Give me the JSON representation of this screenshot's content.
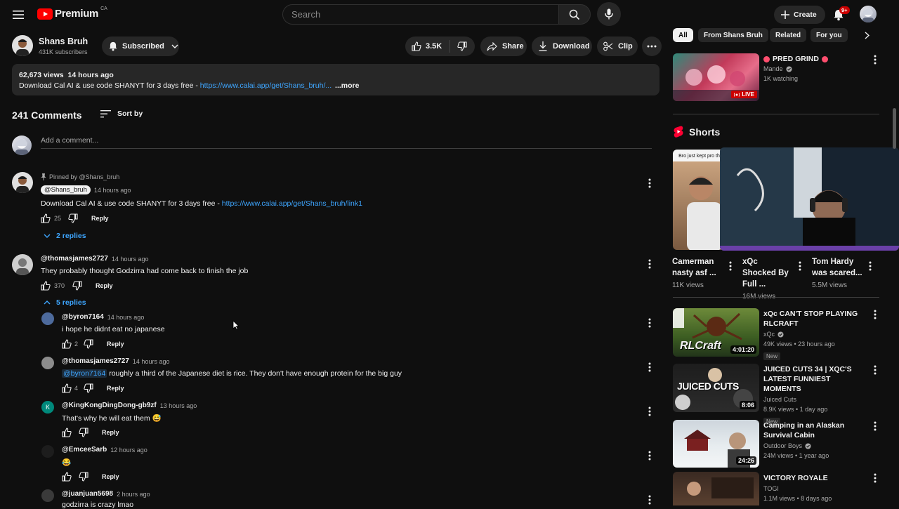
{
  "header": {
    "logo_text": "Premium",
    "region": "CA",
    "search_placeholder": "Search",
    "create_label": "Create",
    "notification_count": "9+"
  },
  "channel": {
    "name": "Shans Bruh",
    "subscribers": "431K subscribers",
    "subscribed_label": "Subscribed",
    "likes": "3.5K",
    "share_label": "Share",
    "download_label": "Download",
    "clip_label": "Clip"
  },
  "description": {
    "views": "62,673 views",
    "age": "14 hours ago",
    "text": "Download Cal AI & use code SHANYT for 3 days free - ",
    "link": "https://www.calai.app/get/Shans_bruh/...",
    "more": "...more"
  },
  "comments_header": {
    "count_label": "241 Comments",
    "sort_label": "Sort by",
    "add_placeholder": "Add a comment..."
  },
  "comments": [
    {
      "pinned": "Pinned by @Shans_bruh",
      "handle": "@Shans_bruh",
      "time": "14 hours ago",
      "text": "Download Cal AI & use code SHANYT for 3 days free - ",
      "link": "https://www.calai.app/get/Shans_bruh/link1",
      "likes": "25",
      "reply": "Reply",
      "replies_toggle": "2 replies"
    },
    {
      "handle": "@thomasjames2727",
      "time": "14 hours ago",
      "text": "They probably thought Godzirra had come back to finish the job",
      "likes": "370",
      "reply": "Reply",
      "replies_toggle": "5 replies"
    }
  ],
  "replies": [
    {
      "handle": "@byron7164",
      "time": "14 hours ago",
      "text": "i hope he didnt eat no japanese",
      "likes": "2",
      "reply": "Reply"
    },
    {
      "handle": "@thomasjames2727",
      "time": "14 hours ago",
      "mention": "@byron7164",
      "text": " roughly a third of the Japanese diet is rice. They don't have enough protein for the big guy",
      "likes": "4",
      "reply": "Reply"
    },
    {
      "handle": "@KingKongDingDong-gb9zf",
      "time": "13 hours ago",
      "text": "That's why he will eat them 😅",
      "likes": "",
      "reply": "Reply",
      "avatar_letter": "K"
    },
    {
      "handle": "@EmceeSarb",
      "time": "12 hours ago",
      "text": "😂",
      "likes": "",
      "reply": "Reply"
    },
    {
      "handle": "@juanjuan5698",
      "time": "2 hours ago",
      "text": "godzirra is crazy lmao",
      "likes": "",
      "reply": "Reply"
    }
  ],
  "sidebar": {
    "chips": [
      "All",
      "From Shans Bruh",
      "Related",
      "For you"
    ],
    "live": {
      "title": "PRED GRIND",
      "channel": "Mande",
      "meta": "1K watching",
      "badge": "LIVE"
    },
    "shorts_title": "Shorts",
    "shorts": [
      {
        "title": "Camerman nasty asf ...",
        "views": "11K views",
        "overlay": "Bro just kept pro the point"
      },
      {
        "title": "xQc Shocked By Full ...",
        "views": "16M views"
      },
      {
        "title": "Tom Hardy was scared...",
        "views": "5.5M views"
      }
    ],
    "videos": [
      {
        "title": "xQc CAN'T STOP PLAYING RLCRAFT",
        "channel": "xQc",
        "meta": "49K views • 23 hours ago",
        "duration": "4:01:20",
        "badge": "New",
        "thumb_text": "RLCraft"
      },
      {
        "title": "JUICED CUTS 34 | XQC'S LATEST FUNNIEST MOMENTS",
        "channel": "Juiced Cuts",
        "meta": "8.9K views • 1 day ago",
        "duration": "8:06",
        "badge": "New",
        "thumb_text": "JUICED CUTS"
      },
      {
        "title": "Camping in an Alaskan Survival Cabin",
        "channel": "Outdoor Boys",
        "meta": "24M views • 1 year ago",
        "duration": "24:26"
      },
      {
        "title": "VICTORY ROYALE",
        "channel": "TOGI",
        "meta": "1.1M views • 8 days ago",
        "duration": ""
      }
    ]
  },
  "colors": {
    "accent": "#ff0000",
    "link": "#3ea6ff",
    "background": "#0f0f0f",
    "surface": "#272727"
  }
}
